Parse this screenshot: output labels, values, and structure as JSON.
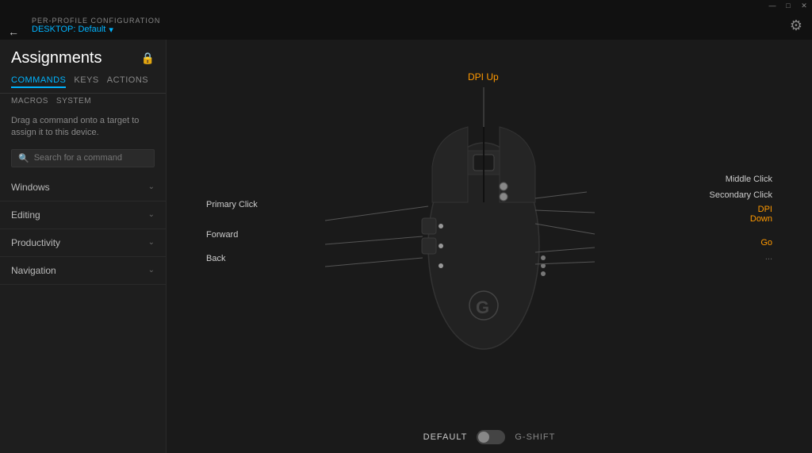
{
  "titlebar": {
    "minimize": "—",
    "restore": "□",
    "close": "✕"
  },
  "topbar": {
    "per_profile_label": "PER-PROFILE CONFIGURATION",
    "desktop_label": "DESKTOP: Default",
    "chevron": "▾"
  },
  "sidebar": {
    "title": "Assignments",
    "lock_icon": "🔒",
    "tabs": [
      {
        "label": "COMMANDS",
        "active": true
      },
      {
        "label": "KEYS",
        "active": false
      },
      {
        "label": "ACTIONS",
        "active": false
      }
    ],
    "subtabs": [
      {
        "label": "MACROS",
        "active": false
      },
      {
        "label": "SYSTEM",
        "active": false
      }
    ],
    "description": "Drag a command onto a target to assign it to this device.",
    "search_placeholder": "Search for a command",
    "categories": [
      {
        "label": "Windows"
      },
      {
        "label": "Editing"
      },
      {
        "label": "Productivity"
      },
      {
        "label": "Navigation"
      }
    ]
  },
  "mouse": {
    "labels": {
      "dpi_up": "DPI Up",
      "middle_click": "Middle Click",
      "secondary_click": "Secondary Click",
      "dpi_down": "DPI",
      "dpi_down_suffix": "Down",
      "primary_click": "Primary Click",
      "forward": "Forward",
      "go": "Go",
      "back": "Back",
      "dots": "..."
    }
  },
  "bottom": {
    "default_label": "DEFAULT",
    "gshift_label": "G-SHIFT"
  }
}
